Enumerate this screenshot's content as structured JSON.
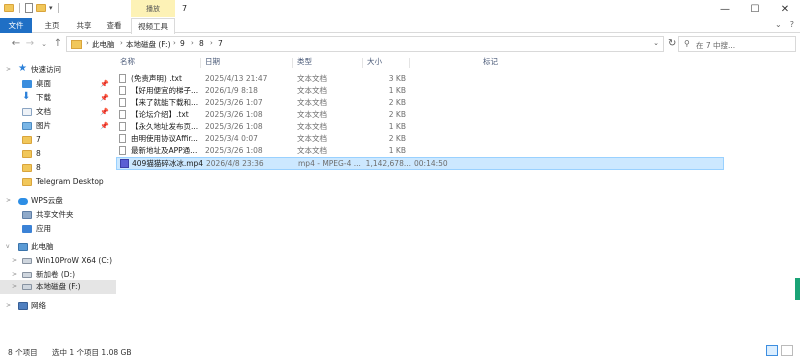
{
  "window": {
    "title": "7",
    "context_tab_header": "播放",
    "controls": {
      "minimize": "—",
      "maximize": "☐",
      "close": "✕"
    }
  },
  "ribbon": {
    "tabs": [
      "文件",
      "主页",
      "共享",
      "查看",
      "视频工具"
    ],
    "collapse": "⌄",
    "help": "?"
  },
  "nav": {
    "back": "←",
    "forward": "→",
    "recent": "⌄",
    "up": "↑"
  },
  "address": {
    "crumbs": [
      "此电脑",
      "本地磁盘 (F:)",
      "9",
      "8",
      "7"
    ],
    "separator": "›",
    "dropdown": "⌄",
    "refresh": "↻"
  },
  "search": {
    "placeholder": "在 7 中搜...",
    "icon": "search-icon"
  },
  "sidebar": {
    "items": [
      {
        "label": "快速访问",
        "icon": "star-icon",
        "level": 0
      },
      {
        "label": "桌面",
        "icon": "desktop-icon",
        "level": 1,
        "pinned": true
      },
      {
        "label": "下载",
        "icon": "download-icon",
        "level": 1,
        "pinned": true
      },
      {
        "label": "文档",
        "icon": "documents-icon",
        "level": 1,
        "pinned": true
      },
      {
        "label": "图片",
        "icon": "pictures-icon",
        "level": 1,
        "pinned": true
      },
      {
        "label": "7",
        "icon": "folder-icon",
        "level": 1
      },
      {
        "label": "8",
        "icon": "folder-icon",
        "level": 1
      },
      {
        "label": "8",
        "icon": "folder-icon",
        "level": 1
      },
      {
        "label": "Telegram Desktop",
        "icon": "folder-icon",
        "level": 1
      },
      {
        "label": "WPS云盘",
        "icon": "cloud-icon",
        "level": 0
      },
      {
        "label": "共享文件夹",
        "icon": "shared-folder-icon",
        "level": 1
      },
      {
        "label": "应用",
        "icon": "apps-icon",
        "level": 1
      },
      {
        "label": "此电脑",
        "icon": "computer-icon",
        "level": 0
      },
      {
        "label": "Win10ProW X64 (C:)",
        "icon": "drive-icon",
        "level": 1
      },
      {
        "label": "新加卷 (D:)",
        "icon": "drive-icon",
        "level": 1
      },
      {
        "label": "本地磁盘 (F:)",
        "icon": "drive-icon",
        "level": 1,
        "selected": true
      },
      {
        "label": "网络",
        "icon": "network-icon",
        "level": 0
      }
    ],
    "pin_glyph": "📌"
  },
  "columns": [
    "名称",
    "日期",
    "类型",
    "大小",
    "标记"
  ],
  "files": [
    {
      "name": "(免责声明) .txt",
      "date": "2025/4/13 21:47",
      "type": "文本文档",
      "size": "3 KB",
      "tag": "",
      "kind": "txt"
    },
    {
      "name": "【好用便宜的梯子...",
      "date": "2026/1/9 8:18",
      "type": "文本文档",
      "size": "1 KB",
      "tag": "",
      "kind": "txt"
    },
    {
      "name": "【来了就能下载和...",
      "date": "2025/3/26 1:07",
      "type": "文本文档",
      "size": "2 KB",
      "tag": "",
      "kind": "txt"
    },
    {
      "name": "【论坛介绍】.txt",
      "date": "2025/3/26 1:08",
      "type": "文本文档",
      "size": "2 KB",
      "tag": "",
      "kind": "txt"
    },
    {
      "name": "【永久地址发布页...",
      "date": "2025/3/26 1:08",
      "type": "文本文档",
      "size": "1 KB",
      "tag": "",
      "kind": "txt"
    },
    {
      "name": "由明使用协议Affir...",
      "date": "2025/3/4 0:07",
      "type": "文本文档",
      "size": "2 KB",
      "tag": "",
      "kind": "txt"
    },
    {
      "name": "最新地址及APP通...",
      "date": "2025/3/26 1:08",
      "type": "文本文档",
      "size": "1 KB",
      "tag": "",
      "kind": "txt"
    },
    {
      "name": "409猫猫碎冰冰.mp4",
      "date": "2026/4/8 23:36",
      "type": "mp4 - MPEG-4 ...",
      "size": "1,142,678...",
      "tag": "00:14:50",
      "kind": "mp4",
      "selected": true
    }
  ],
  "status": {
    "count": "8 个项目",
    "selection": "选中 1 个项目  1.08 GB"
  },
  "colors": {
    "file_tab": "#1f6fc5",
    "context_tab": "#fdf2b6",
    "selection_fill": "#cce8ff",
    "selection_border": "#99d1ff",
    "folder": "#f1c75a"
  }
}
